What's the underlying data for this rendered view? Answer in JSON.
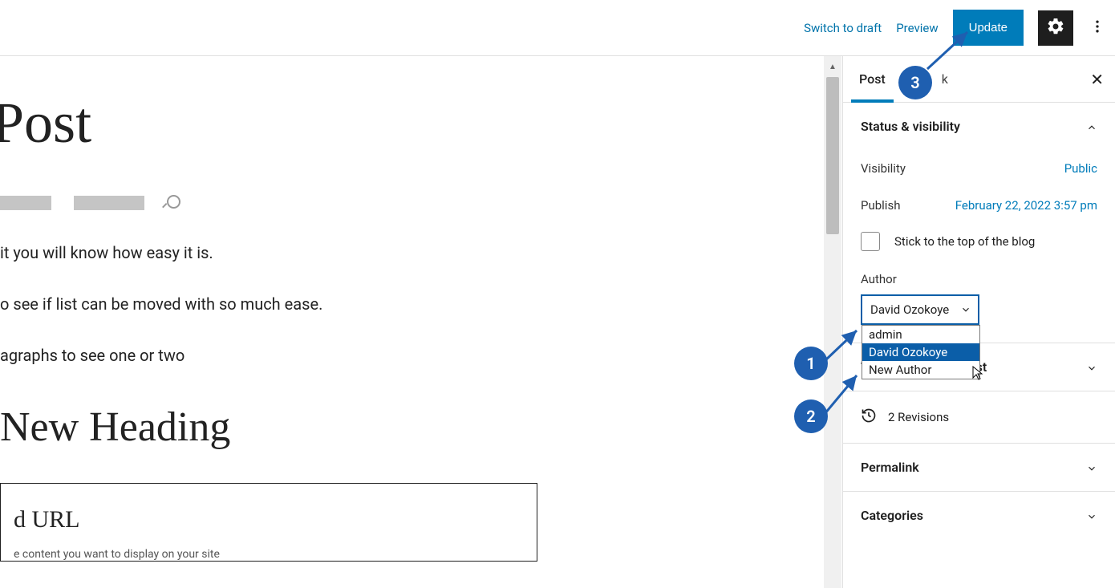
{
  "topbar": {
    "switch_draft": "Switch to draft",
    "preview": "Preview",
    "update": "Update"
  },
  "editor": {
    "title": "Post",
    "para1": "it you will know how easy it is.",
    "para2": "o see if list can be moved with so much ease.",
    "para3": "agraphs to see one or two",
    "heading": "New Heading",
    "embed_title": "d URL",
    "embed_sub": "e content you want to display on your site"
  },
  "sidebar": {
    "tabs": {
      "post": "Post",
      "block": "k"
    },
    "status": {
      "title": "Status & visibility",
      "visibility_label": "Visibility",
      "visibility_value": "Public",
      "publish_label": "Publish",
      "publish_value": "February 22, 2022 3:57 pm",
      "stick_label": "Stick to the top of the blog",
      "author_label": "Author",
      "author_selected": "David Ozokoye",
      "author_options": [
        "admin",
        "David Ozokoye",
        "New Author"
      ]
    },
    "template": "Template: Single Post",
    "revisions": "2 Revisions",
    "permalink": "Permalink",
    "categories": "Categories"
  },
  "annotations": {
    "b1": "1",
    "b2": "2",
    "b3": "3"
  }
}
